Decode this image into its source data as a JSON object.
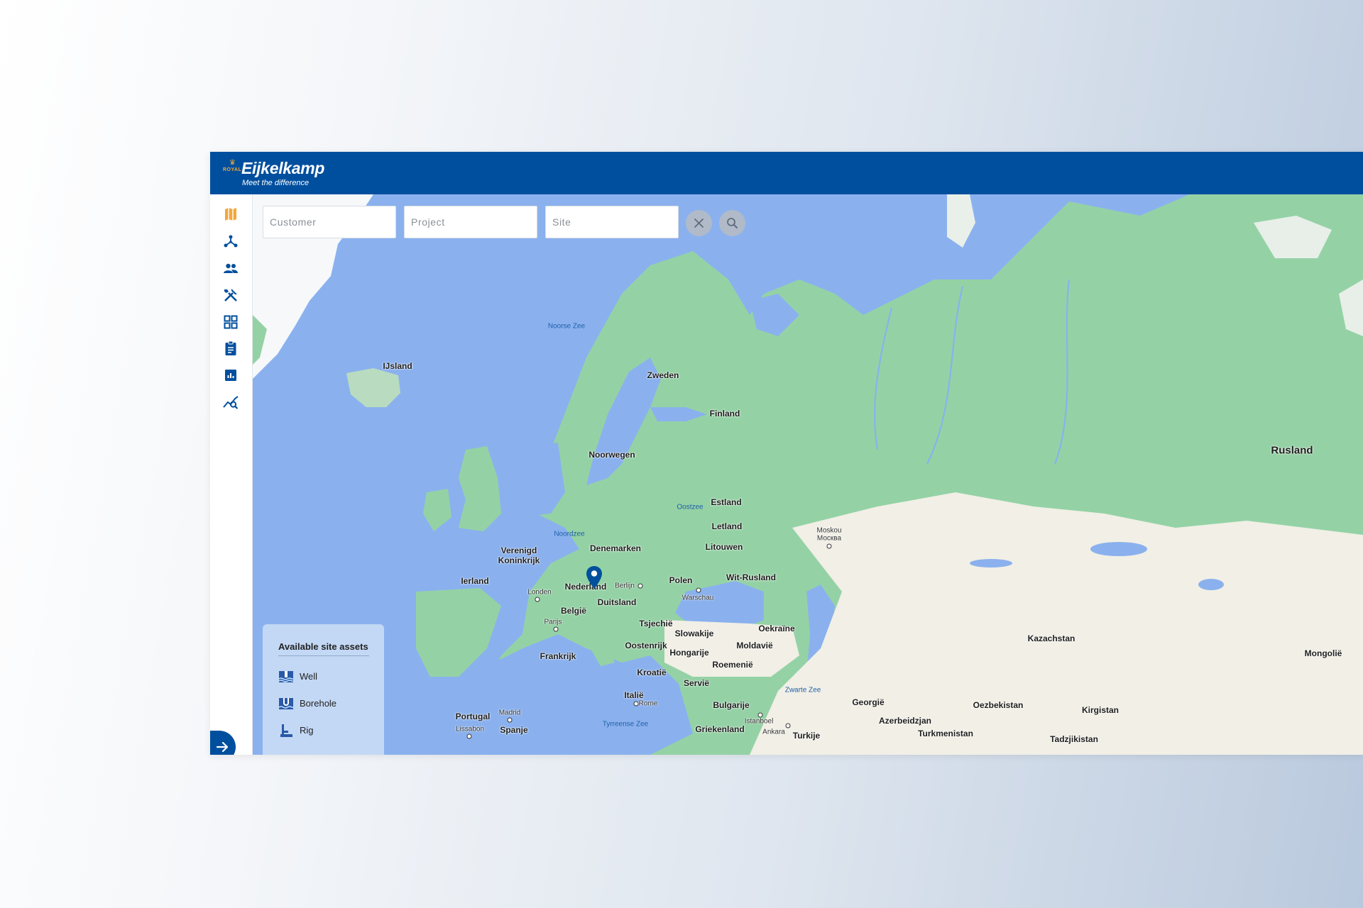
{
  "app": {
    "brand_royal": "ROYAL",
    "brand_name": "Eijkelkamp",
    "brand_tagline": "Meet the difference"
  },
  "sidebar": {
    "items": [
      {
        "icon": "map-icon",
        "active": true
      },
      {
        "icon": "network-icon"
      },
      {
        "icon": "people-icon"
      },
      {
        "icon": "tools-icon"
      },
      {
        "icon": "grid-icon"
      },
      {
        "icon": "clipboard-icon"
      },
      {
        "icon": "bar-chart-icon"
      },
      {
        "icon": "chart-search-icon"
      }
    ],
    "expand_icon": "arrow-right-icon"
  },
  "search": {
    "customer_placeholder": "Customer",
    "project_placeholder": "Project",
    "site_placeholder": "Site",
    "clear_icon": "close-icon",
    "search_icon": "search-icon"
  },
  "legend": {
    "title": "Available site assets",
    "items": [
      {
        "label": "Well",
        "icon": "well-icon"
      },
      {
        "label": "Borehole",
        "icon": "borehole-icon"
      },
      {
        "label": "Rig",
        "icon": "rig-icon"
      }
    ]
  },
  "map": {
    "countries": {
      "ijsland": "IJsland",
      "zweden": "Zweden",
      "finland": "Finland",
      "noorwegen": "Noorwegen",
      "rusland": "Rusland",
      "estland": "Estland",
      "letland": "Letland",
      "litouwen": "Litouwen",
      "denemarken": "Denemarken",
      "vk1": "Verenigd",
      "vk2": "Koninkrijk",
      "ierland": "Ierland",
      "nederland": "Nederland",
      "duitsland": "Duitsland",
      "polen": "Polen",
      "witrusland": "Wit-Rusland",
      "belgie": "België",
      "tsjechie": "Tsjechië",
      "slowakije": "Slowakije",
      "oekraine": "Oekraïne",
      "frankrijk": "Frankrijk",
      "oostenrijk": "Oostenrijk",
      "hongarije": "Hongarije",
      "moldavie": "Moldavië",
      "kazachstan": "Kazachstan",
      "mongolie": "Mongolië",
      "roemenie": "Roemenië",
      "kroatie": "Kroatië",
      "servie": "Servië",
      "italie": "Italië",
      "bulgarije": "Bulgarije",
      "georgie": "Georgië",
      "oezbekistan": "Oezbekistan",
      "kirgistan": "Kirgistan",
      "portugal": "Portugal",
      "spanje": "Spanje",
      "griekenland": "Griekenland",
      "turkije": "Turkije",
      "azerbeidzjan": "Azerbeidzjan",
      "turkmenistan": "Turkmenistan",
      "tadzjikistan": "Tadzjikistan"
    },
    "cities": {
      "moskou": "Moskou",
      "moskva": "Москва",
      "berlijn": "Berlijn",
      "warschau": "Warschau",
      "londen": "Londen",
      "parijs": "Parijs",
      "rome": "Rome",
      "madrid": "Madrid",
      "lissabon": "Lissabon",
      "istanboel": "Istanboel",
      "ankara": "Ankara"
    },
    "seas": {
      "noorse": "Noorse Zee",
      "oostzee": "Oostzee",
      "noordzee": "Noordzee",
      "zwarte": "Zwarte Zee",
      "tyrreense": "Tyrreense Zee"
    },
    "colors": {
      "water": "#8ab1ee",
      "land": "#94d2a5",
      "steppe": "#f1efe6",
      "snow": "#ffffff",
      "brand": "#004f9e",
      "accent": "#f2a73b"
    }
  }
}
